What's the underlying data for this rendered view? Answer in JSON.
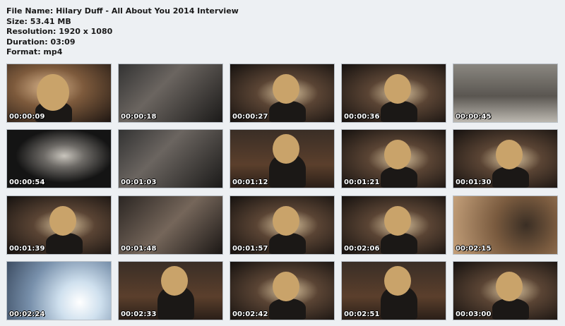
{
  "file_info": {
    "name_line": "File Name: Hilary Duff - All About You 2014 Interview",
    "size_line": "Size: 53.41 MB",
    "resolution_line": "Resolution: 1920 x 1080",
    "duration_line": "Duration: 03:09",
    "format_line": "Format: mp4"
  },
  "thumbnails": [
    {
      "timestamp": "00:00:09",
      "scene": "closeup"
    },
    {
      "timestamp": "00:00:18",
      "scene": "party"
    },
    {
      "timestamp": "00:00:27",
      "scene": "dark"
    },
    {
      "timestamp": "00:00:36",
      "scene": "dark"
    },
    {
      "timestamp": "00:00:45",
      "scene": "street"
    },
    {
      "timestamp": "00:00:54",
      "scene": "silhouettes"
    },
    {
      "timestamp": "00:01:03",
      "scene": "party"
    },
    {
      "timestamp": "00:01:12",
      "scene": "room"
    },
    {
      "timestamp": "00:01:21",
      "scene": "dark"
    },
    {
      "timestamp": "00:01:30",
      "scene": "dark"
    },
    {
      "timestamp": "00:01:39",
      "scene": "dark"
    },
    {
      "timestamp": "00:01:48",
      "scene": "crowd"
    },
    {
      "timestamp": "00:01:57",
      "scene": "dark"
    },
    {
      "timestamp": "00:02:06",
      "scene": "dark"
    },
    {
      "timestamp": "00:02:15",
      "scene": "mechanism"
    },
    {
      "timestamp": "00:02:24",
      "scene": "light"
    },
    {
      "timestamp": "00:02:33",
      "scene": "room"
    },
    {
      "timestamp": "00:02:42",
      "scene": "dark"
    },
    {
      "timestamp": "00:02:51",
      "scene": "room"
    },
    {
      "timestamp": "00:03:00",
      "scene": "dark"
    }
  ]
}
